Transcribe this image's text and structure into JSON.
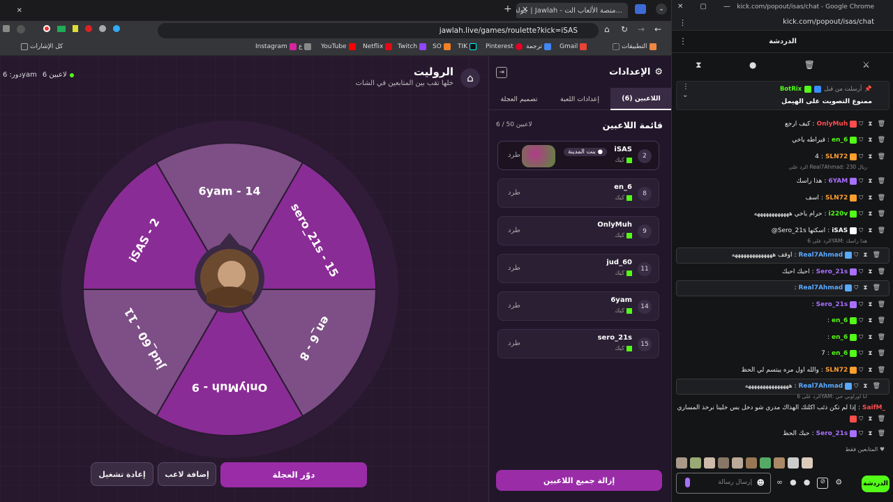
{
  "browser": {
    "tab_title": "جولة | Jawlah - منصة الألعاب الت...",
    "url": "jawlah.live/games/roulette?kick=iSAS",
    "bookmarks": [
      "التطبيقات",
      "Gmail",
      "ترجمة",
      "Pinterest",
      "TIK",
      "SO",
      "Twitch",
      "Netflix",
      "YouTube",
      "ع",
      "Instagram",
      "كل الإشارات"
    ]
  },
  "game": {
    "title": "الروليت",
    "subtitle": "خلها تقب بين المتابعين في الشات",
    "players_count": "6 لاعبين",
    "turn_label": "دور: 6yam",
    "wheel_segments": [
      {
        "label": "6yam - 14",
        "color": "#7d4f86"
      },
      {
        "label": "sero_21s - 15",
        "color": "#8a2c96"
      },
      {
        "label": "en_6 - 8",
        "color": "#7d4f86"
      },
      {
        "label": "OnlyMuh - 9",
        "color": "#8a2c96"
      },
      {
        "label": "jud_60 - 11",
        "color": "#7d4f86"
      },
      {
        "label": "iSAS - 2",
        "color": "#8a2c96"
      }
    ],
    "spin_button": "دوّر العجلة",
    "add_player_button": "إضافة لاعب",
    "restart_button": "إعادة تشغيل"
  },
  "settings": {
    "title": "الإعدادات",
    "tabs": [
      "اللاعبين (6)",
      "إعدادات اللعبة",
      "تصميم العجلة"
    ],
    "list_title": "قائمة اللاعبين",
    "list_count": "6 / 50 لاعبين",
    "players": [
      {
        "rank": "2",
        "name": "iSAS",
        "platform": "كيك",
        "kick": "طرد",
        "badge": "بنت المدينة"
      },
      {
        "rank": "8",
        "name": "en_6",
        "platform": "كيك",
        "kick": "طرد"
      },
      {
        "rank": "9",
        "name": "OnlyMuh",
        "platform": "كيك",
        "kick": "طرد"
      },
      {
        "rank": "11",
        "name": "jud_60",
        "platform": "كيك",
        "kick": "طرد"
      },
      {
        "rank": "14",
        "name": "6yam",
        "platform": "كيك",
        "kick": "طرد"
      },
      {
        "rank": "15",
        "name": "sero_21s",
        "platform": "كيك",
        "kick": "طرد"
      }
    ],
    "remove_all_button": "إزالة جميع اللاعبين"
  },
  "chat_window": {
    "title": "kick.com/popout/isas/chat - Google Chrome",
    "url": "kick.com/popout/isas/chat",
    "header": "الدردشة",
    "pinned_by": "أرسلت من قبل",
    "pinned_user": "BotRix",
    "pinned_text": "ممنوع التصويت على الهيمل",
    "messages": [
      {
        "user": "OnlyMuh",
        "color": "#ff4d4d",
        "text": "كيف ارجع"
      },
      {
        "user": "en_6",
        "color": "#53fc18",
        "text": "قيراطه ياخي"
      },
      {
        "user": "SLN72",
        "color": "#ff9f2e",
        "text": "4"
      },
      {
        "reply": "الرد على Real7Ahmad: 230 ريال"
      },
      {
        "user": "6YAM",
        "color": "#a970ff",
        "text": "هذا راسك"
      },
      {
        "user": "SLN72",
        "color": "#ff9f2e",
        "text": "اسف"
      },
      {
        "user": "i220v",
        "color": "#53fc18",
        "text": "حرام ياخي ههههههههههههه"
      },
      {
        "user": "iSAS",
        "color": "#ffffff",
        "text": "@Sero_21s اسكتها"
      },
      {
        "reply": "الرد على 6YAM: هذا راسك"
      },
      {
        "user": "Real7Ahmad",
        "color": "#5aa9ff",
        "text": "اوقف ههههههههههههههه",
        "hl": true
      },
      {
        "user": "Sero_21s",
        "color": "#a970ff",
        "text": "احبك احبك"
      },
      {
        "user": "Real7Ahmad",
        "color": "#5aa9ff",
        "text": "",
        "hl": true
      },
      {
        "user": "Sero_21s",
        "color": "#a970ff",
        "text": ""
      },
      {
        "user": "en_6",
        "color": "#53fc18",
        "text": ""
      },
      {
        "user": "en_6",
        "color": "#53fc18",
        "text": ""
      },
      {
        "user": "en_6",
        "color": "#53fc18",
        "text": "7"
      },
      {
        "user": "SLN72",
        "color": "#ff9f2e",
        "text": "والله اول مره يبتسم لي الحظ"
      },
      {
        "user": "Real7Ahmad",
        "color": "#5aa9ff",
        "text": "هههههههههههههههه",
        "hl": true
      },
      {
        "reply": "الرد على 6YAM: انا اوراوبي حي"
      },
      {
        "user": "SaifM_",
        "color": "#ff4d4d",
        "text": "إذا لم تكن ذئب اكلتك الهذاك مدري شو دخل بس خلينا نرخذ المساري"
      },
      {
        "user": "Sero_21s",
        "color": "#a970ff",
        "text": "حبك الحظ"
      }
    ],
    "emote_section": "المتابعين فقط",
    "input_placeholder": "إرسال رسالة",
    "send_button": "الدردشة"
  }
}
